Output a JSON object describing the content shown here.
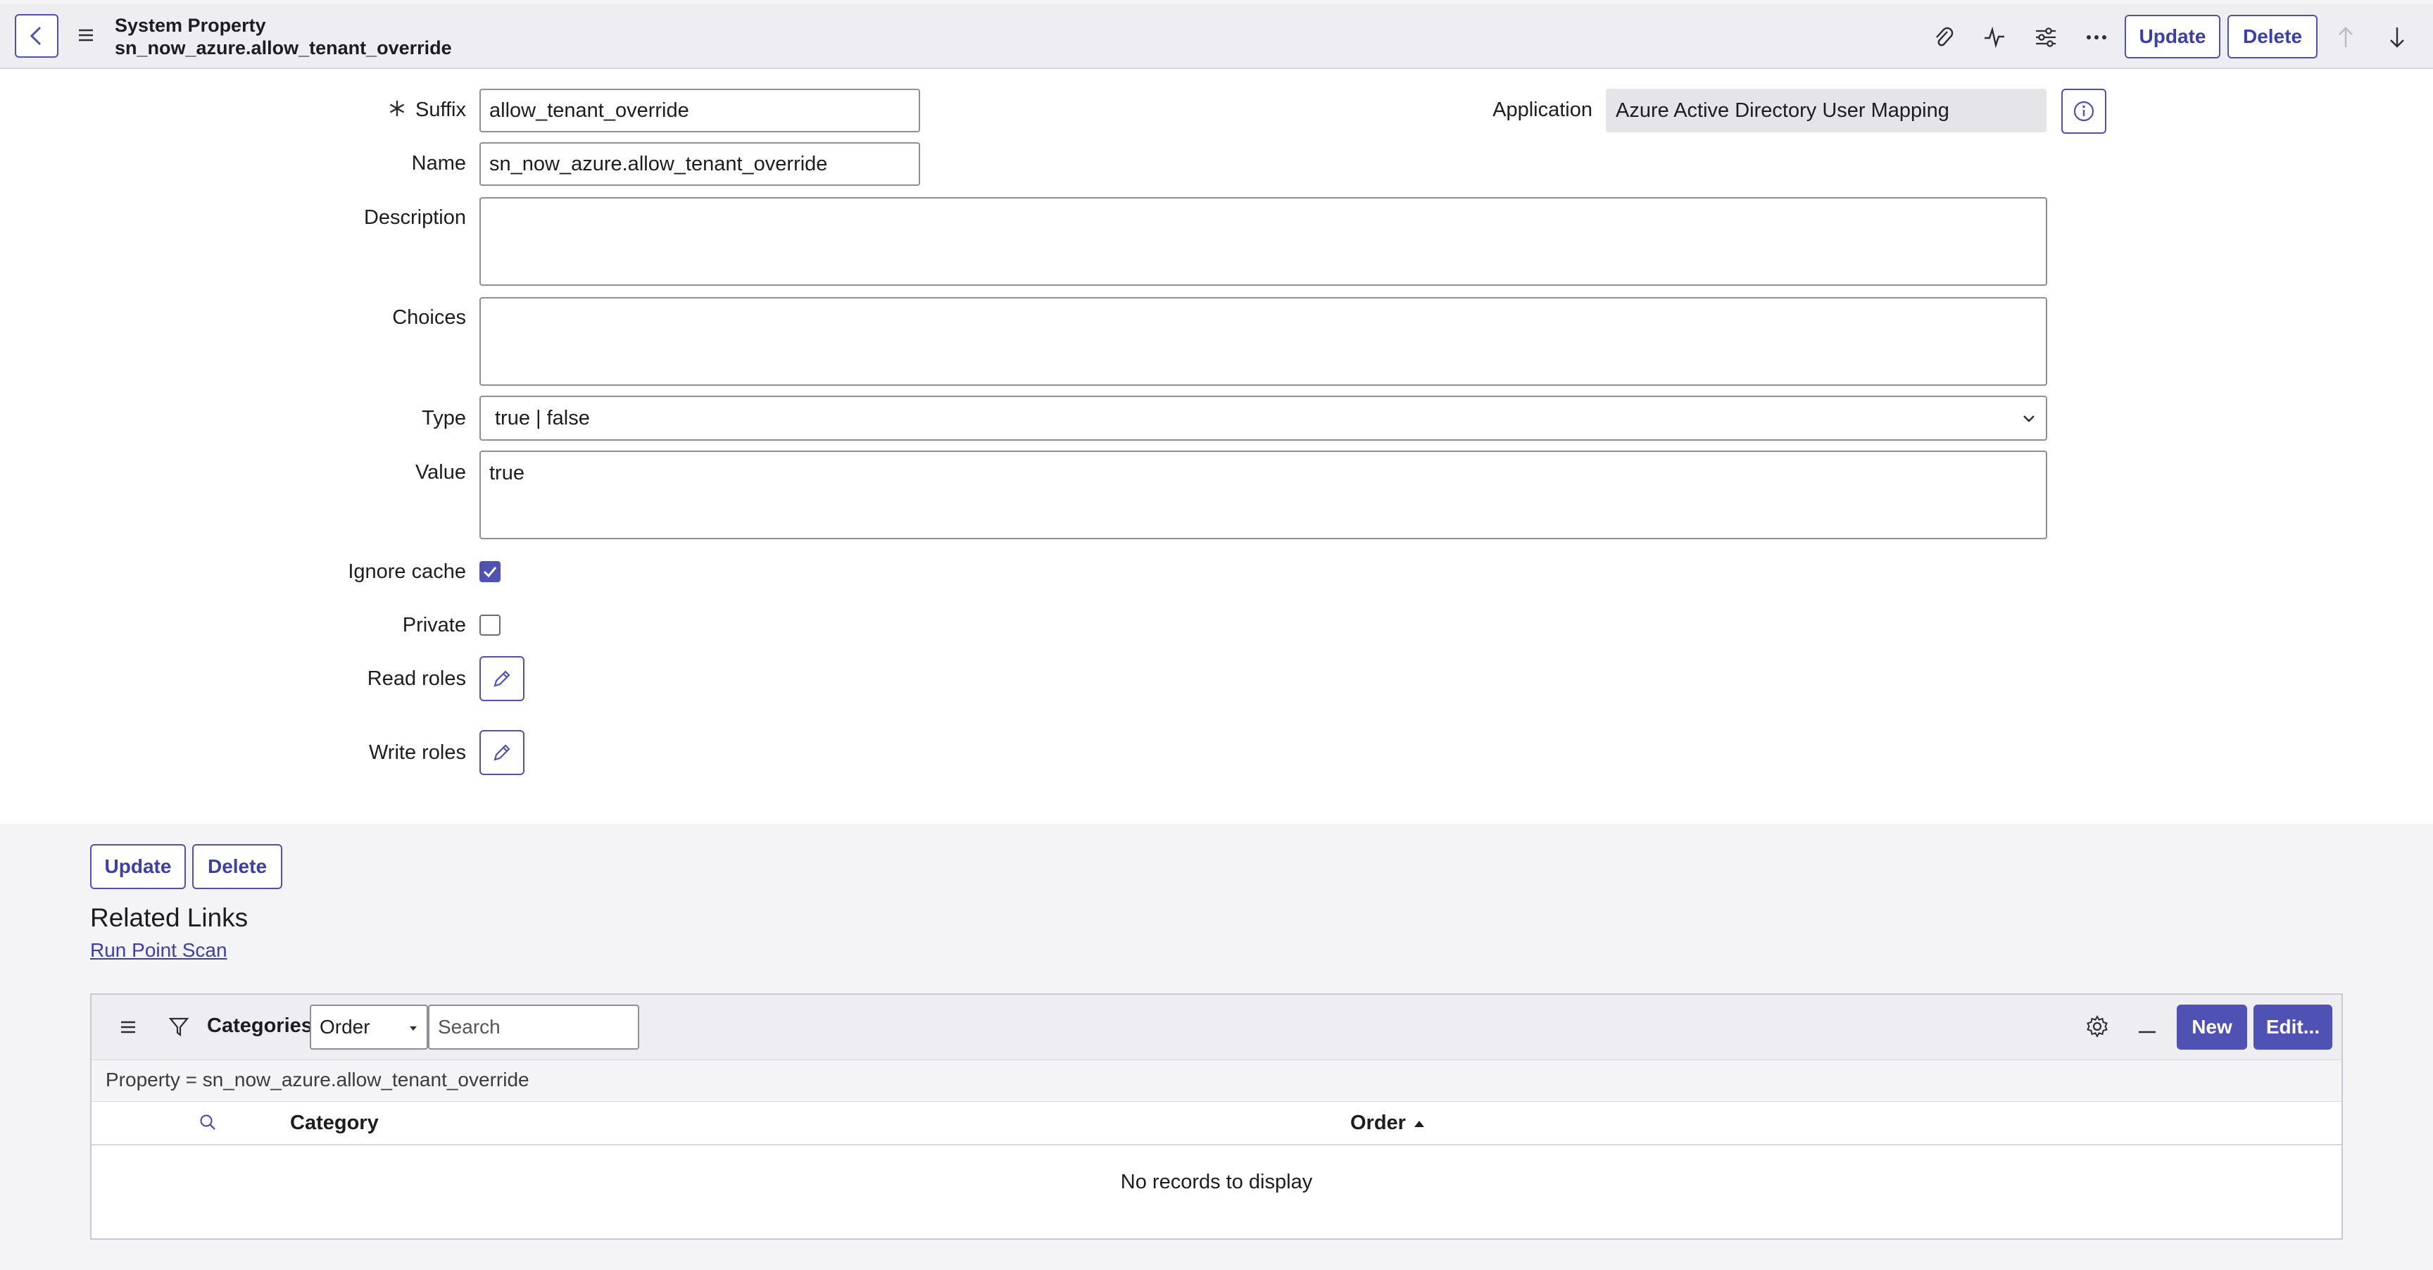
{
  "header": {
    "title": "System Property",
    "subtitle": "sn_now_azure.allow_tenant_override",
    "update_label": "Update",
    "delete_label": "Delete"
  },
  "form": {
    "suffix": {
      "label": "Suffix",
      "value": "allow_tenant_override"
    },
    "name": {
      "label": "Name",
      "value": "sn_now_azure.allow_tenant_override"
    },
    "description": {
      "label": "Description",
      "value": ""
    },
    "choices": {
      "label": "Choices",
      "value": ""
    },
    "type": {
      "label": "Type",
      "value": "true | false"
    },
    "value": {
      "label": "Value",
      "value": "true"
    },
    "ignore_cache": {
      "label": "Ignore cache",
      "checked": true
    },
    "private": {
      "label": "Private",
      "checked": false
    },
    "read_roles": {
      "label": "Read roles"
    },
    "write_roles": {
      "label": "Write roles"
    },
    "application": {
      "label": "Application",
      "value": "Azure Active Directory User Mapping"
    }
  },
  "bottom_actions": {
    "update_label": "Update",
    "delete_label": "Delete"
  },
  "related": {
    "title": "Related Links",
    "links": [
      "Run Point Scan"
    ]
  },
  "list": {
    "title": "Categories",
    "search_field": "Order",
    "search_placeholder": "Search",
    "new_label": "New",
    "edit_label": "Edit...",
    "filter_text": "Property = sn_now_azure.allow_tenant_override",
    "columns": [
      "Category",
      "Order"
    ],
    "empty_text": "No records to display"
  },
  "colors": {
    "accent": "#4f52b2",
    "header_bg": "#eeeef2",
    "page_bg": "#f4f4f7"
  }
}
